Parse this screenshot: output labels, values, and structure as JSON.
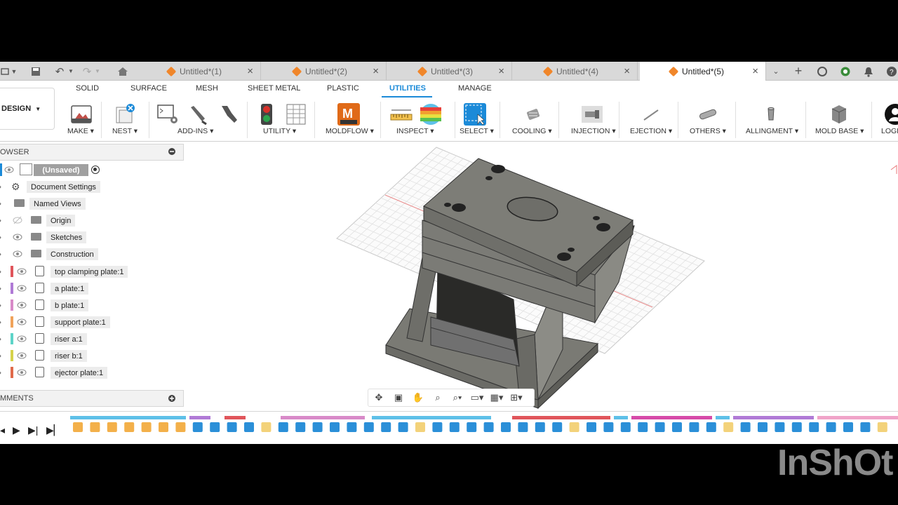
{
  "tabs": [
    {
      "label": "Untitled*(1)",
      "active": false
    },
    {
      "label": "Untitled*(2)",
      "active": false
    },
    {
      "label": "Untitled*(3)",
      "active": false
    },
    {
      "label": "Untitled*(4)",
      "active": false
    },
    {
      "label": "Untitled*(5)",
      "active": true
    }
  ],
  "workspace": {
    "label": "DESIGN"
  },
  "ribbon_tabs": [
    {
      "label": "SOLID",
      "active": false
    },
    {
      "label": "SURFACE",
      "active": false
    },
    {
      "label": "MESH",
      "active": false
    },
    {
      "label": "SHEET METAL",
      "active": false
    },
    {
      "label": "PLASTIC",
      "active": false
    },
    {
      "label": "UTILITIES",
      "active": true
    },
    {
      "label": "MANAGE",
      "active": false
    }
  ],
  "groups": [
    {
      "label": "MAKE ▾"
    },
    {
      "label": "NEST ▾"
    },
    {
      "label": "ADD-INS ▾"
    },
    {
      "label": "UTILITY ▾"
    },
    {
      "label": "MOLDFLOW ▾"
    },
    {
      "label": "INSPECT ▾"
    },
    {
      "label": "SELECT ▾"
    },
    {
      "label": "COOLING ▾"
    },
    {
      "label": "INJECTION ▾"
    },
    {
      "label": "EJECTION ▾"
    },
    {
      "label": "OTHERS ▾"
    },
    {
      "label": "ALLINGMENT ▾"
    },
    {
      "label": "MOLD BASE ▾"
    },
    {
      "label": "LOGI"
    }
  ],
  "browser": {
    "title": "OWSER",
    "root": "(Unsaved)",
    "items": [
      {
        "label": "Document Settings",
        "type": "settings"
      },
      {
        "label": "Named Views",
        "type": "folder"
      },
      {
        "label": "Origin",
        "type": "folder"
      },
      {
        "label": "Sketches",
        "type": "folder"
      },
      {
        "label": "Construction",
        "type": "folder"
      },
      {
        "label": "top clamping plate:1",
        "type": "component",
        "color": "#e0555b"
      },
      {
        "label": "a plate:1",
        "type": "component",
        "color": "#b07ad6"
      },
      {
        "label": "b plate:1",
        "type": "component",
        "color": "#d88ac8"
      },
      {
        "label": "support plate:1",
        "type": "component",
        "color": "#f0a35a"
      },
      {
        "label": "riser a:1",
        "type": "component",
        "color": "#5ed4c8"
      },
      {
        "label": "riser b:1",
        "type": "component",
        "color": "#d6d24a"
      },
      {
        "label": "ejector plate:1",
        "type": "component",
        "color": "#e06a4a"
      }
    ]
  },
  "comments": {
    "label": "MMENTS"
  },
  "watermark": "InShOt",
  "colors": {
    "accent": "#1b8ad8",
    "tab_cube": "#f0862a",
    "model": "#7f7f78"
  }
}
